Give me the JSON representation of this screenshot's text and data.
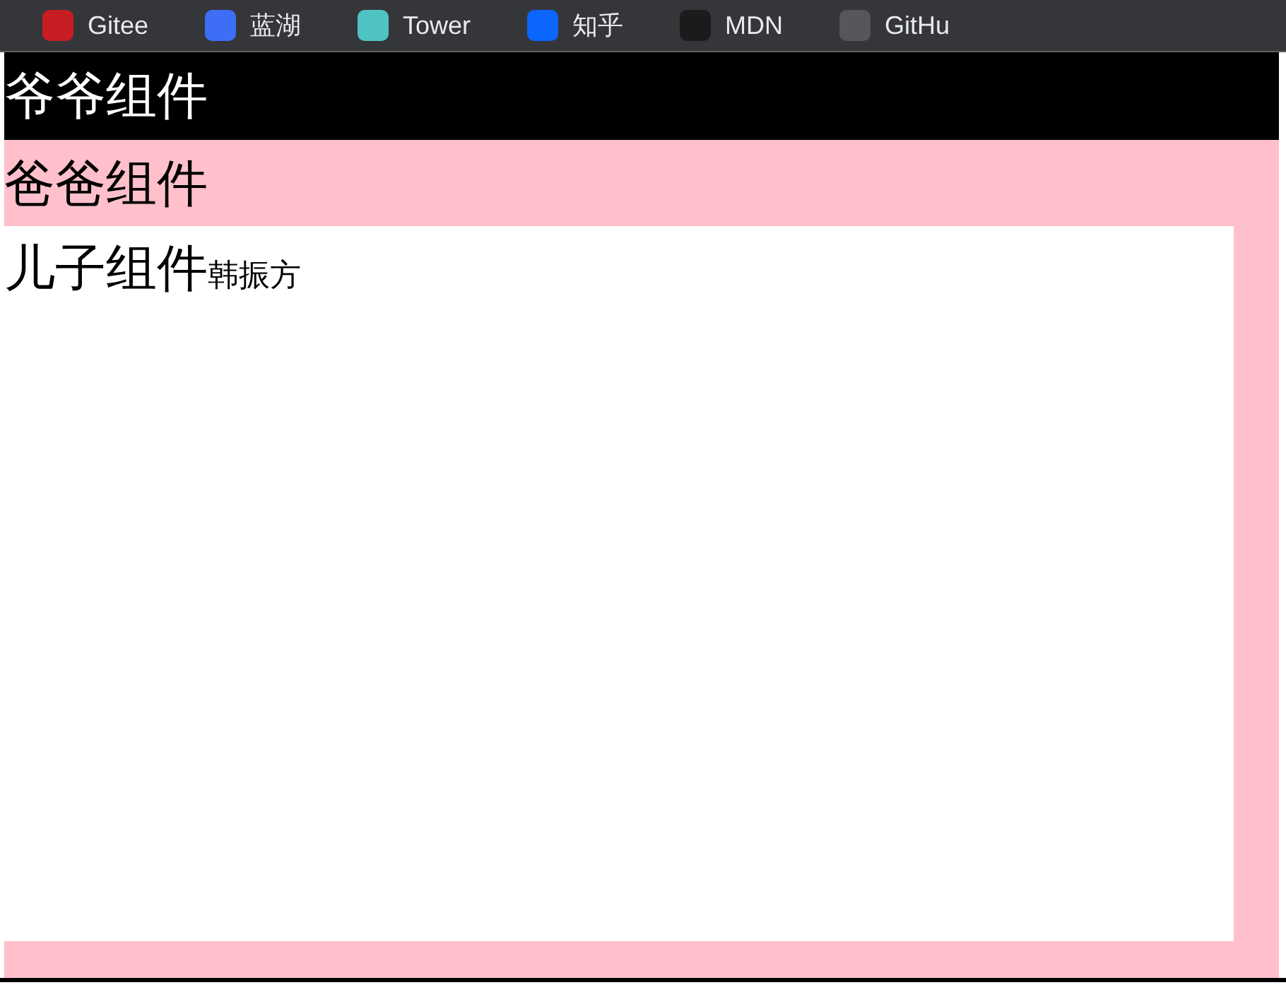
{
  "bookmarks": [
    {
      "label": "Gitee",
      "color": "#c71d23"
    },
    {
      "label": "蓝湖",
      "color": "#3d6ef5"
    },
    {
      "label": "Tower",
      "color": "#4fc3c4"
    },
    {
      "label": "知乎",
      "color": "#0a66ff"
    },
    {
      "label": "MDN",
      "color": "#1b1b1b"
    },
    {
      "label": "GitHu",
      "color": "#55575c"
    }
  ],
  "grandfather": {
    "title": "爷爷组件"
  },
  "father": {
    "title": "爸爸组件"
  },
  "son": {
    "title": "儿子组件",
    "name": "韩振方"
  }
}
